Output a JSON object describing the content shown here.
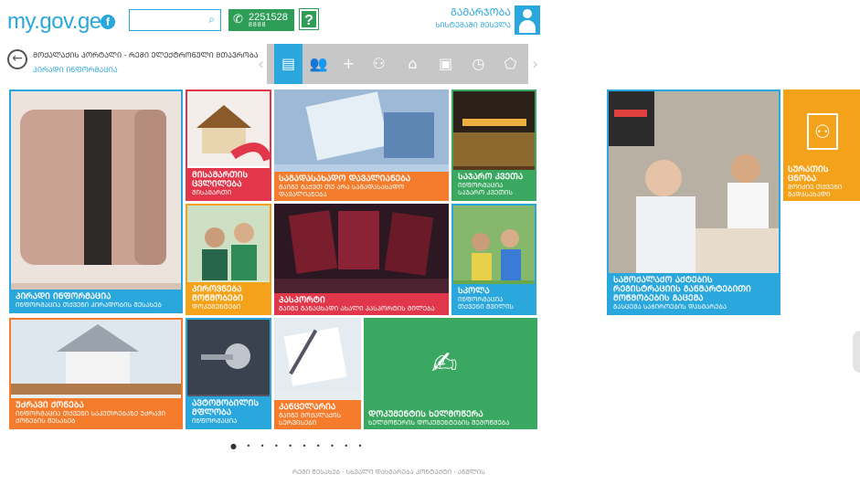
{
  "header": {
    "logo": "my.gov.ge",
    "facebook_icon": "f",
    "search_icon": "⌕",
    "phone_number": "2251528",
    "phone_sub": "8888",
    "help_label": "?",
    "auth_title": "ᲒᲐᲛᲐᲠᲯᲝᲑᲐ",
    "auth_subtitle": "ᲡᲘᲡᲢᲔᲛᲐᲨᲘ ᲨᲔᲡᲕᲚᲐ"
  },
  "breadcrumb": {
    "back_icon": "←",
    "title": "ᲛᲝᲥᲐᲚᲐᲥᲘᲡ ᲞᲝᲠᲢᲐᲚᲘ - ᲠᲔᲛᲘ ᲔᲚᲔᲥᲢᲠᲝᲜᲣᲚᲘ ᲛᲗᲐᲕᲠᲝᲑᲐ",
    "subtitle": "ᲞᲘᲠᲐᲓᲘ ᲘᲜᲤᲝᲠᲛᲐᲪᲘᲐ"
  },
  "icon_bar": {
    "prev": "‹",
    "next": "›",
    "items": [
      {
        "icon": "document-icon",
        "glyph": "▤"
      },
      {
        "icon": "people-icon",
        "glyph": "👥"
      },
      {
        "icon": "plus-icon",
        "glyph": "+"
      },
      {
        "icon": "family-icon",
        "glyph": "⚇"
      },
      {
        "icon": "home-icon",
        "glyph": "⌂"
      },
      {
        "icon": "briefcase-icon",
        "glyph": "▣"
      },
      {
        "icon": "clock-icon",
        "glyph": "◷"
      },
      {
        "icon": "tag-icon",
        "glyph": "⬠"
      }
    ]
  },
  "tiles": [
    {
      "title": "ᲞᲘᲠᲐᲓᲘ ᲘᲜᲤᲝᲠᲛᲐᲪᲘᲐ",
      "sub": "ᲘᲜᲤᲝᲠᲛᲐᲪᲘᲐ ᲗᲥᲕᲔᲜᲘ ᲞᲘᲠᲐᲓᲝᲑᲘᲡ ᲨᲔᲡᲐᲮᲔᲑ",
      "color": "#2aa7dc"
    },
    {
      "title": "ᲛᲘᲡᲐᲛᲐᲠᲗᲘᲡ ᲪᲕᲚᲘᲚᲔᲑᲐ",
      "sub": "ᲛᲘᲡᲐᲛᲐᲠᲗᲘ",
      "color": "#e2374b"
    },
    {
      "title": "ᲡᲐᲒᲐᲓᲐᲡᲐᲮᲐᲓᲝ ᲓᲐᲕᲐᲚᲘᲐᲜᲔᲑᲐ",
      "sub": "ᲒᲐᲘᲒᲔ ᲒᲐᲥᲕᲗ ᲗᲣ ᲐᲠᲐ ᲡᲐᲒᲐᲓᲐᲡᲐᲮᲐᲓᲝ ᲓᲐᲕᲐᲚᲘᲐᲜᲔᲑᲐ",
      "color": "#f47c2c"
    },
    {
      "title": "ᲡᲐᲯᲐᲠᲝ ᲙᲕᲔᲗᲐ",
      "sub": "ᲘᲜᲤᲝᲠᲛᲐᲪᲘᲐ ᲡᲐᲯᲐᲠᲝ ᲙᲕᲔᲗᲘᲡ",
      "color": "#3aa860"
    },
    {
      "title": "ᲞᲘᲠᲝᲕᲜᲔᲑᲐ ᲛᲝᲬᲛᲝᲑᲔᲑᲘ",
      "sub": "ᲓᲝᲙᲣᲛᲔᲜᲢᲔᲑᲘ",
      "color": "#f5a21b"
    },
    {
      "title": "ᲞᲐᲡᲞᲝᲠᲢᲘ",
      "sub": "ᲒᲐᲘᲒᲔ ᲒᲐᲜᲐᲪᲮᲐᲓᲘ ᲐᲮᲐᲚᲘ ᲞᲐᲡᲞᲝᲠᲢᲘᲡ ᲛᲘᲚᲔᲑᲐ",
      "color": "#e2374b"
    },
    {
      "title": "ᲡᲙᲝᲚᲐ",
      "sub": "ᲘᲜᲤᲝᲠᲛᲐᲪᲘᲐ ᲗᲥᲕᲔᲜᲘ ᲨᲕᲘᲚᲘᲡ",
      "color": "#2aa7dc"
    },
    {
      "title": "ᲣᲫᲠᲐᲕᲘ ᲥᲝᲜᲔᲑᲐ",
      "sub": "ᲘᲜᲤᲝᲠᲛᲐᲪᲘᲐ ᲗᲥᲕᲔᲜᲘ ᲡᲐᲙᲣᲗᲠᲔᲑᲐᲖᲔ ᲣᲫᲠᲐᲕᲘ ᲥᲝᲜᲔᲑᲘᲡ ᲨᲔᲡᲐᲮᲔᲑ",
      "color": "#f47c2c"
    },
    {
      "title": "ᲐᲕᲢᲝᲛᲝᲑᲘᲚᲘᲡ ᲛᲤᲚᲝᲑᲐ",
      "sub": "ᲘᲜᲤᲝᲠᲛᲐᲪᲘᲐ",
      "color": "#2aa7dc"
    },
    {
      "title": "ᲙᲐᲜᲪᲔᲚᲐᲠᲘᲐ",
      "sub": "ᲒᲐᲘᲒᲔ ᲛᲝᲥᲐᲚᲐᲥᲘᲡ ᲡᲔᲠᲕᲘᲡᲔᲑᲘ",
      "color": "#f47c2c"
    },
    {
      "title": "ᲓᲝᲙᲣᲛᲔᲜᲢᲘᲡ ᲮᲔᲚᲛᲝᲬᲔᲠᲐ",
      "sub": "ᲮᲔᲚᲛᲝᲬᲔᲠᲘᲡ ᲓᲝᲙᲣᲛᲔᲜᲢᲔᲑᲘᲡ ᲨᲔᲛᲝᲬᲛᲔᲑᲐ",
      "color": "#3aa860"
    },
    {
      "title": "ᲡᲐᲛᲝᲥᲐᲚᲐᲥᲝ ᲐᲥᲢᲔᲑᲘᲡ ᲠᲔᲒᲘᲡᲢᲠᲐᲪᲘᲘᲡ ᲒᲐᲜᲛᲐᲠᲢᲔᲑᲘᲗᲘ ᲛᲝᲬᲛᲝᲑᲔᲑᲘᲡ ᲒᲐᲪᲔᲛᲐ",
      "sub": "ᲒᲐᲡᲪᲔᲛᲐ ᲡᲐᲭᲘᲠᲝᲔᲑᲘᲡ ᲓᲐᲮᲛᲐᲠᲔᲑᲐ",
      "color": "#2aa7dc"
    },
    {
      "title": "ᲡᲣᲠᲐᲗᲘᲡ ᲪᲜᲝᲑᲐ",
      "sub": "ᲛᲝᲘᲫᲘᲔ ᲗᲥᲕᲔᲜᲘ ᲒᲐᲓᲐᲡᲐᲮᲐᲓᲘ",
      "color": "#f5a21b"
    }
  ],
  "pager": "● • • • • • • • • •",
  "footer": "ᲠᲔᲛᲘ ᲨᲔᲡᲐᲮᲔᲑ · ᲡᲮᲕᲐᲚᲘ ᲓᲐᲮᲛᲐᲠᲔᲑᲐ ᲙᲝᲜᲢᲐᲥᲢᲘ · ᲐᲜᲒᲚᲘᲡ"
}
